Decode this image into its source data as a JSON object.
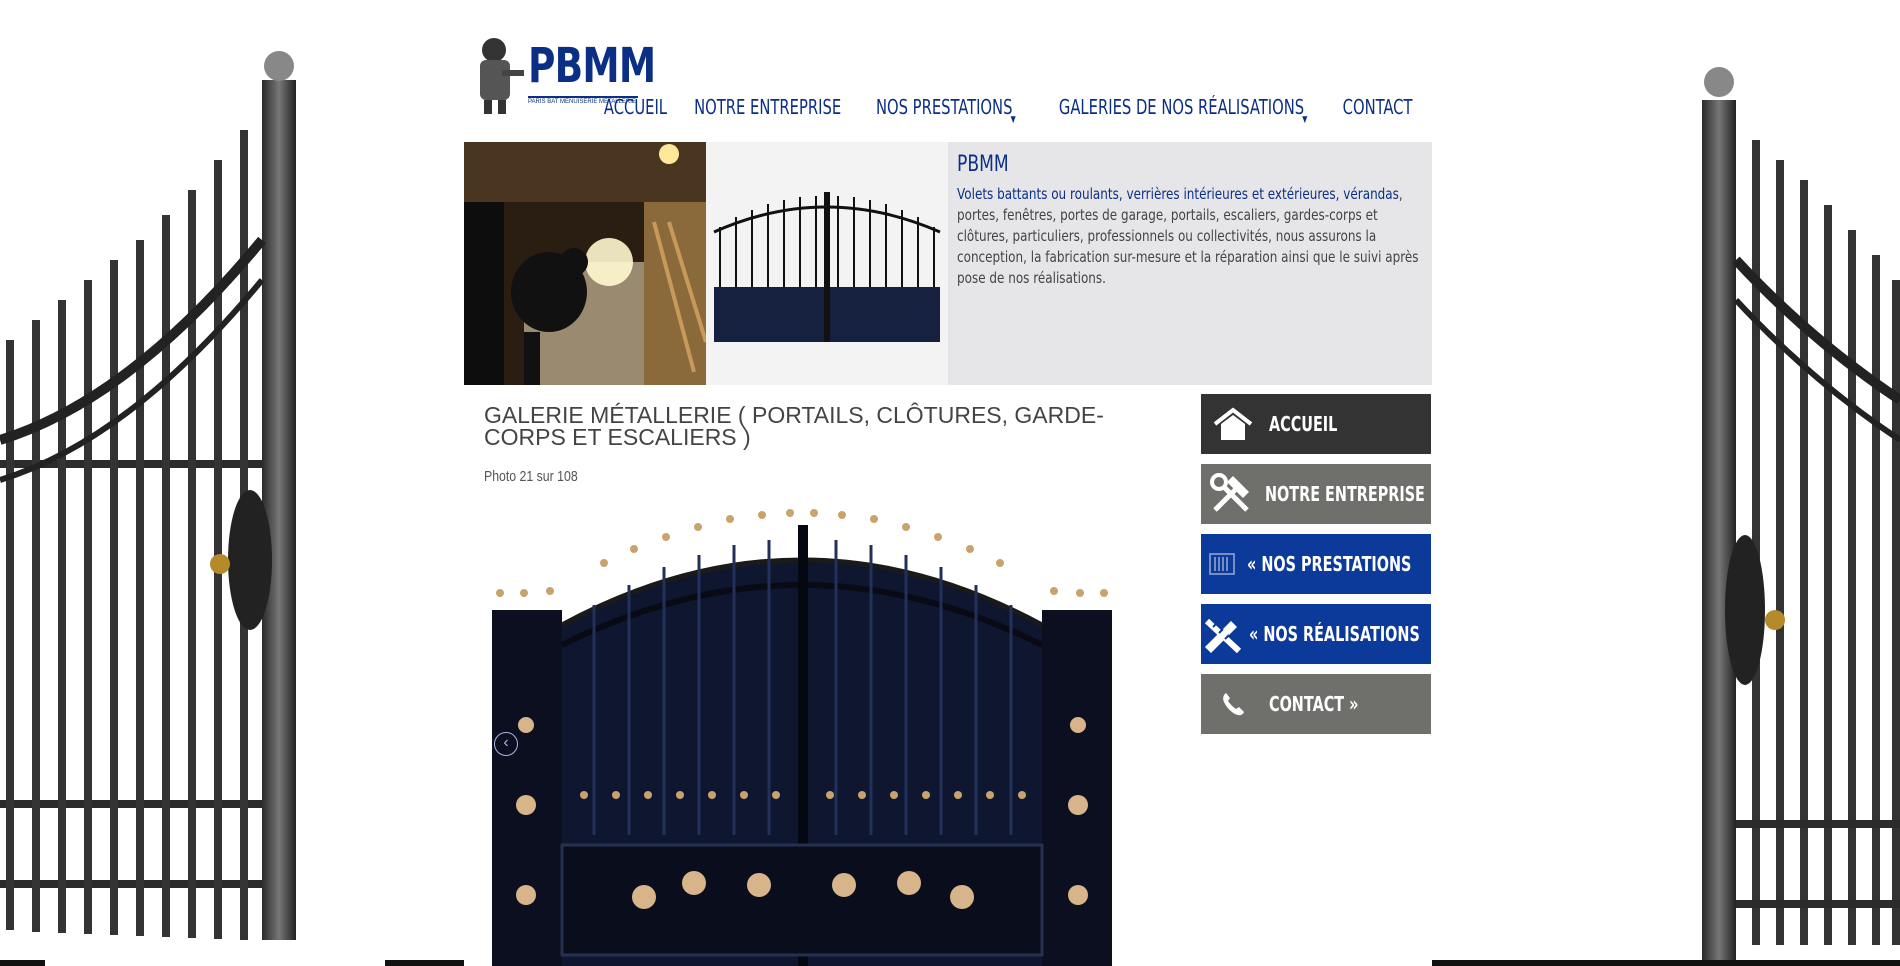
{
  "brand": {
    "name": "PBMM",
    "tagline": "PARIS BAT MENUISERIE METALLERIE",
    "color": "#0c2f86"
  },
  "topnav": {
    "items": [
      {
        "label": "ACCUEIL",
        "has_submenu": false
      },
      {
        "label": "NOTRE ENTREPRISE",
        "has_submenu": false
      },
      {
        "label": "NOS PRESTATIONS",
        "has_submenu": true
      },
      {
        "label": "GALERIES DE NOS RÉALISATIONS",
        "has_submenu": true
      },
      {
        "label": "CONTACT",
        "has_submenu": false
      }
    ]
  },
  "banner": {
    "title": "PBMM",
    "text_highlight": "Volets battants ou roulants, verrières intérieures et extérieures, vérandas",
    "text_rest": ", portes, fenêtres, portes de garage, portails, escaliers, gardes-corps et clôtures, particuliers, professionnels ou collectivités, nous assurons la conception, la fabrication sur-mesure et la réparation ainsi que le suivi après pose de nos réalisations."
  },
  "gallery": {
    "title": "GALERIE MÉTALLERIE ( PORTAILS, CLÔTURES, GARDE-CORPS ET ESCALIERS )",
    "counter": "Photo 21 sur 108"
  },
  "sidemenu": {
    "items": [
      {
        "label": "ACCUEIL",
        "icon": "home-icon",
        "style": "dark"
      },
      {
        "label": "NOTRE ENTREPRISE »",
        "icon": "tools-icon",
        "style": "grey"
      },
      {
        "label": "« NOS PRESTATIONS",
        "icon": "barcode-icon",
        "style": "blue"
      },
      {
        "label": "« NOS RÉALISATIONS",
        "icon": "ruler-pencil-icon",
        "style": "blue"
      },
      {
        "label": "CONTACT »",
        "icon": "phone-icon",
        "style": "grey"
      }
    ]
  },
  "colors": {
    "dark": "#333333",
    "grey": "#6f6f6b",
    "blue": "#0c3a9a",
    "banner_bg": "#e6e6e9"
  }
}
